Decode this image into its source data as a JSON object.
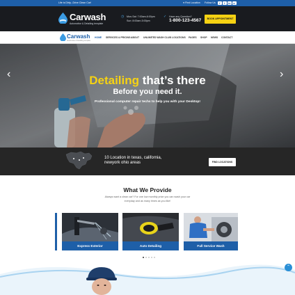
{
  "topbar": {
    "tagline": "Life is Dirty...Drive Clean Car!",
    "find_location": "Find Location",
    "follow_us": "Follow Us",
    "social": [
      "facebook-icon",
      "twitter-icon",
      "linkedin-icon",
      "youtube-icon"
    ]
  },
  "header": {
    "brand": "Carwash",
    "brand_tagline": "Automotive & Detailing template",
    "hours_line1": "Mon-Sat: 7:00am-6:00pm",
    "hours_line2": "Sun: 8:00am-5:00pm",
    "question": "Have any Question?",
    "phone": "1-800-123-4567",
    "book_button": "BOOK APPOINTMENT"
  },
  "nav": {
    "brand": "Carwash",
    "brand_tagline": "Automotive & Detailing template",
    "items": [
      "HOME",
      "SERVICES & PRICING",
      "ABOUT",
      "UNLIMITED WASH CLUB",
      "LOCATIONS",
      "PAGES",
      "SHOP",
      "NEWS",
      "CONTACT"
    ]
  },
  "hero": {
    "title_highlight": "Detailing",
    "title_rest": "that’s there",
    "subtitle": "Before you need it.",
    "description": "Professional computer repair techs to help you with your Desktop!",
    "prev_arrow": "‹",
    "next_arrow": "›"
  },
  "locations": {
    "line1": "10 Location in texas, california,",
    "line2": "newyork ohio areas",
    "button": "FIND LOCATIONS"
  },
  "provide": {
    "title": "What We Provide",
    "desc_line1": "Always want a clean car? For one low monthly price you can wash your car",
    "desc_line2": "everyday and as many times as you like!",
    "cards": [
      "Express Exterior",
      "Auto Detailing",
      "Full Service Wash"
    ],
    "dots": 5,
    "active_dot": 0
  },
  "scroll_top": "⌃",
  "colors": {
    "brand_blue": "#1e5fa8",
    "accent_yellow": "#f6d213",
    "dark_header": "#191b1f",
    "location_band": "#262626"
  }
}
